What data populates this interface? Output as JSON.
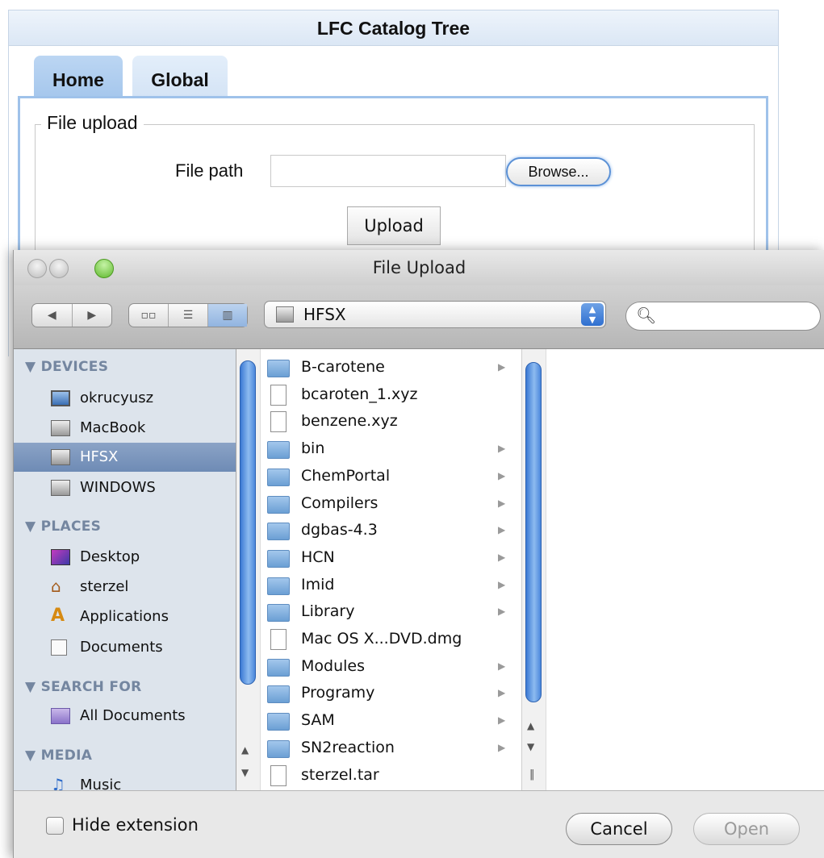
{
  "webpage": {
    "title": "LFC Catalog Tree",
    "tabs": [
      {
        "label": "Home"
      },
      {
        "label": "Global"
      }
    ],
    "fieldset_legend": "File upload",
    "file_path_label": "File path",
    "file_path_value": "",
    "browse_label": "Browse...",
    "upload_label": "Upload"
  },
  "dialog": {
    "title": "File Upload",
    "location": "HFSX",
    "search_placeholder": "",
    "sidebar": {
      "sections": [
        {
          "header": "DEVICES",
          "items": [
            {
              "label": "okrucyusz",
              "icon": "laptop-icon"
            },
            {
              "label": "MacBook",
              "icon": "disk-icon"
            },
            {
              "label": "HFSX",
              "icon": "disk-icon",
              "selected": true
            },
            {
              "label": "WINDOWS",
              "icon": "disk-icon"
            }
          ]
        },
        {
          "header": "PLACES",
          "items": [
            {
              "label": "Desktop",
              "icon": "desktop-icon"
            },
            {
              "label": "sterzel",
              "icon": "home-icon"
            },
            {
              "label": "Applications",
              "icon": "applications-icon"
            },
            {
              "label": "Documents",
              "icon": "documents-icon"
            }
          ]
        },
        {
          "header": "SEARCH FOR",
          "items": [
            {
              "label": "All Documents",
              "icon": "smart-folder-icon"
            }
          ]
        },
        {
          "header": "MEDIA",
          "items": [
            {
              "label": "Music",
              "icon": "music-icon"
            }
          ]
        }
      ]
    },
    "files": [
      {
        "name": "B-carotene",
        "type": "folder"
      },
      {
        "name": "bcaroten_1.xyz",
        "type": "file"
      },
      {
        "name": "benzene.xyz",
        "type": "file"
      },
      {
        "name": "bin",
        "type": "folder"
      },
      {
        "name": "ChemPortal",
        "type": "folder"
      },
      {
        "name": "Compilers",
        "type": "folder"
      },
      {
        "name": "dgbas-4.3",
        "type": "folder"
      },
      {
        "name": "HCN",
        "type": "folder"
      },
      {
        "name": "Imid",
        "type": "folder"
      },
      {
        "name": "Library",
        "type": "folder"
      },
      {
        "name": "Mac OS X...DVD.dmg",
        "type": "file"
      },
      {
        "name": "Modules",
        "type": "folder"
      },
      {
        "name": "Programy",
        "type": "folder"
      },
      {
        "name": "SAM",
        "type": "folder"
      },
      {
        "name": "SN2reaction",
        "type": "folder"
      },
      {
        "name": "sterzel.tar",
        "type": "file"
      }
    ],
    "hide_extension_label": "Hide extension",
    "hide_extension_checked": false,
    "cancel_label": "Cancel",
    "open_label": "Open"
  }
}
